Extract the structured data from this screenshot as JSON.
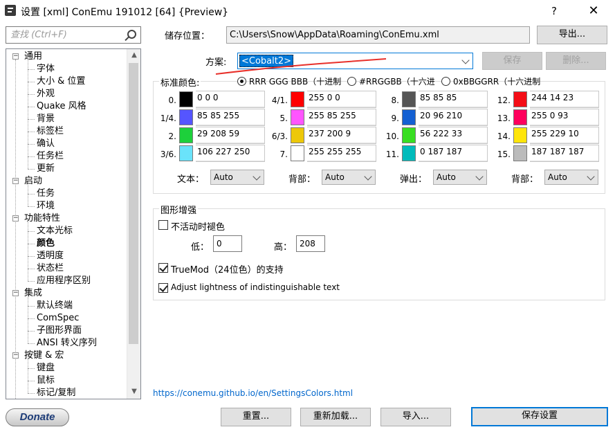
{
  "window": {
    "title": "设置 [xml] ConEmu 191012 [64] {Preview}",
    "help_label": "?",
    "close_label": "✕"
  },
  "search": {
    "placeholder": "查找 (Ctrl+F)"
  },
  "tree": {
    "items": [
      {
        "label": "通用",
        "level": 0,
        "expanded": true
      },
      {
        "label": "字体",
        "level": 1
      },
      {
        "label": "大小 & 位置",
        "level": 1
      },
      {
        "label": "外观",
        "level": 1
      },
      {
        "label": "Quake 风格",
        "level": 1
      },
      {
        "label": "背景",
        "level": 1
      },
      {
        "label": "标签栏",
        "level": 1
      },
      {
        "label": "确认",
        "level": 1
      },
      {
        "label": "任务栏",
        "level": 1
      },
      {
        "label": "更新",
        "level": 1
      },
      {
        "label": "启动",
        "level": 0,
        "expanded": true
      },
      {
        "label": "任务",
        "level": 1
      },
      {
        "label": "环境",
        "level": 1
      },
      {
        "label": "功能特性",
        "level": 0,
        "expanded": true
      },
      {
        "label": "文本光标",
        "level": 1
      },
      {
        "label": "颜色",
        "level": 1,
        "selected": true
      },
      {
        "label": "透明度",
        "level": 1
      },
      {
        "label": "状态栏",
        "level": 1
      },
      {
        "label": "应用程序区别",
        "level": 1
      },
      {
        "label": "集成",
        "level": 0,
        "expanded": true
      },
      {
        "label": "默认终端",
        "level": 1
      },
      {
        "label": "ComSpec",
        "level": 1
      },
      {
        "label": "子图形界面",
        "level": 1
      },
      {
        "label": "ANSI 转义序列",
        "level": 1
      },
      {
        "label": "按键 & 宏",
        "level": 0,
        "expanded": true
      },
      {
        "label": "键盘",
        "level": 1
      },
      {
        "label": "鼠标",
        "level": 1
      },
      {
        "label": "标记/复制",
        "level": 1
      }
    ],
    "scroll_up": "▲",
    "scroll_down": "▼",
    "expander_symbol": "−"
  },
  "storage": {
    "label": "储存位置：",
    "path": "C:\\Users\\Snow\\AppData\\Roaming\\ConEmu.xml",
    "export_button": "导出..."
  },
  "scheme": {
    "label": "方案:",
    "value": "<Cobalt2>",
    "save_button": "保存",
    "delete_button": "删除..."
  },
  "palette": {
    "title": "标准颜色:",
    "formats": [
      {
        "label": "RRR GGG BBB（十进制",
        "checked": true
      },
      {
        "label": "#RRGGBB（十六进",
        "checked": false
      },
      {
        "label": "0xBBGGRR（十六进制",
        "checked": false
      }
    ],
    "columns": [
      [
        {
          "index": "0.",
          "color": "#000000",
          "value": "0 0 0"
        },
        {
          "index": "1/4.",
          "color": "#5555ff",
          "value": "85 85 255"
        },
        {
          "index": "2.",
          "color": "#1dd03b",
          "value": "29 208 59"
        },
        {
          "index": "3/6.",
          "color": "#6ae3fa",
          "value": "106 227 250"
        }
      ],
      [
        {
          "index": "4/1.",
          "color": "#ff0000",
          "value": "255 0 0"
        },
        {
          "index": "5.",
          "color": "#ff55ff",
          "value": "255 85 255"
        },
        {
          "index": "6/3.",
          "color": "#edc809",
          "value": "237 200 9"
        },
        {
          "index": "7.",
          "color": "#ffffff",
          "value": "255 255 255"
        }
      ],
      [
        {
          "index": "8.",
          "color": "#555555",
          "value": "85 85 85"
        },
        {
          "index": "9.",
          "color": "#1460d2",
          "value": "20 96 210"
        },
        {
          "index": "10.",
          "color": "#38de21",
          "value": "56 222 33"
        },
        {
          "index": "11.",
          "color": "#00bbbb",
          "value": "0 187 187"
        }
      ],
      [
        {
          "index": "12.",
          "color": "#f40e17",
          "value": "244 14 23"
        },
        {
          "index": "13.",
          "color": "#ff005d",
          "value": "255 0 93"
        },
        {
          "index": "14.",
          "color": "#ffe50a",
          "value": "255 229 10"
        },
        {
          "index": "15.",
          "color": "#bbbbbb",
          "value": "187 187 187"
        }
      ]
    ],
    "selectors": [
      {
        "label": "文本：",
        "value": "Auto"
      },
      {
        "label": "背部：",
        "value": "Auto"
      },
      {
        "label": "弹出：",
        "value": "Auto"
      },
      {
        "label": "背部：",
        "value": "Auto"
      }
    ]
  },
  "graphics": {
    "title": "图形增强",
    "fade_inactive": {
      "label": "不活动时褪色",
      "checked": false
    },
    "low_label": "低：",
    "low_value": "0",
    "high_label": "高：",
    "high_value": "208",
    "truemod": {
      "label": "TrueMod（24位色）的支持",
      "checked": true
    },
    "adjust_lightness": {
      "label": "Adjust lightness of indistinguishable text",
      "checked": true
    }
  },
  "help_link": "https://conemu.github.io/en/SettingsColors.html",
  "buttons": {
    "donate": "Donate",
    "reset": "重置...",
    "reload": "重新加载...",
    "import": "导入...",
    "save_settings": "保存设置"
  },
  "colors": {
    "accent": "#0078d7",
    "link": "#0066cc",
    "annotation_stroke": "#e8302a"
  }
}
